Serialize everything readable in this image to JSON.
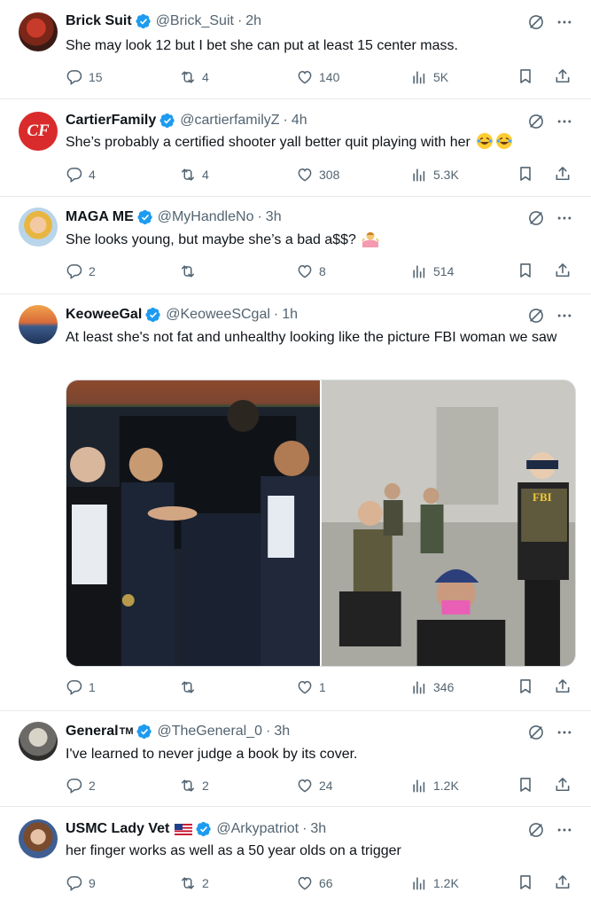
{
  "tweets": [
    {
      "name": "Brick Suit",
      "handle": "@Brick_Suit",
      "time": "2h",
      "text": "She may look 12 but I bet she can put at least 15 center mass.",
      "replies": "15",
      "retweets": "4",
      "likes": "140",
      "views": "5K"
    },
    {
      "name": "CartierFamily",
      "handle": "@cartierfamilyZ",
      "time": "4h",
      "text": "She’s probably a certified shooter yall better quit playing with her",
      "replies": "4",
      "retweets": "4",
      "likes": "308",
      "views": "5.3K",
      "avatar_text": "CF"
    },
    {
      "name": "MAGA ME",
      "handle": "@MyHandleNo",
      "time": "3h",
      "text": "She looks young, but maybe she’s a bad a$$?",
      "replies": "2",
      "retweets": "",
      "likes": "8",
      "views": "514"
    },
    {
      "name": "KeoweeGal",
      "handle": "@KeoweeSCgal",
      "time": "1h",
      "text": "At least she's not fat and unhealthy looking like the picture  FBI woman we saw",
      "replies": "1",
      "retweets": "",
      "likes": "1",
      "views": "346",
      "media_label": "FBI"
    },
    {
      "name": "General",
      "name_suffix": "TM",
      "handle": "@TheGeneral_0",
      "time": "3h",
      "text": "I've learned to never judge a book by its cover.",
      "replies": "2",
      "retweets": "2",
      "likes": "24",
      "views": "1.2K"
    },
    {
      "name": "USMC Lady Vet",
      "handle": "@Arkypatriot",
      "time": "3h",
      "text": "her finger works as well as a 50 year olds on a trigger",
      "replies": "9",
      "retweets": "2",
      "likes": "66",
      "views": "1.2K"
    }
  ],
  "colors": {
    "verified": "#1d9bf0",
    "muted": "#536471",
    "text": "#0f1419",
    "divider": "#e6e9ec"
  },
  "icons": [
    "verified-badge-icon",
    "grok-icon",
    "more-icon",
    "reply-icon",
    "retweet-icon",
    "like-icon",
    "views-icon",
    "bookmark-icon",
    "share-icon"
  ]
}
